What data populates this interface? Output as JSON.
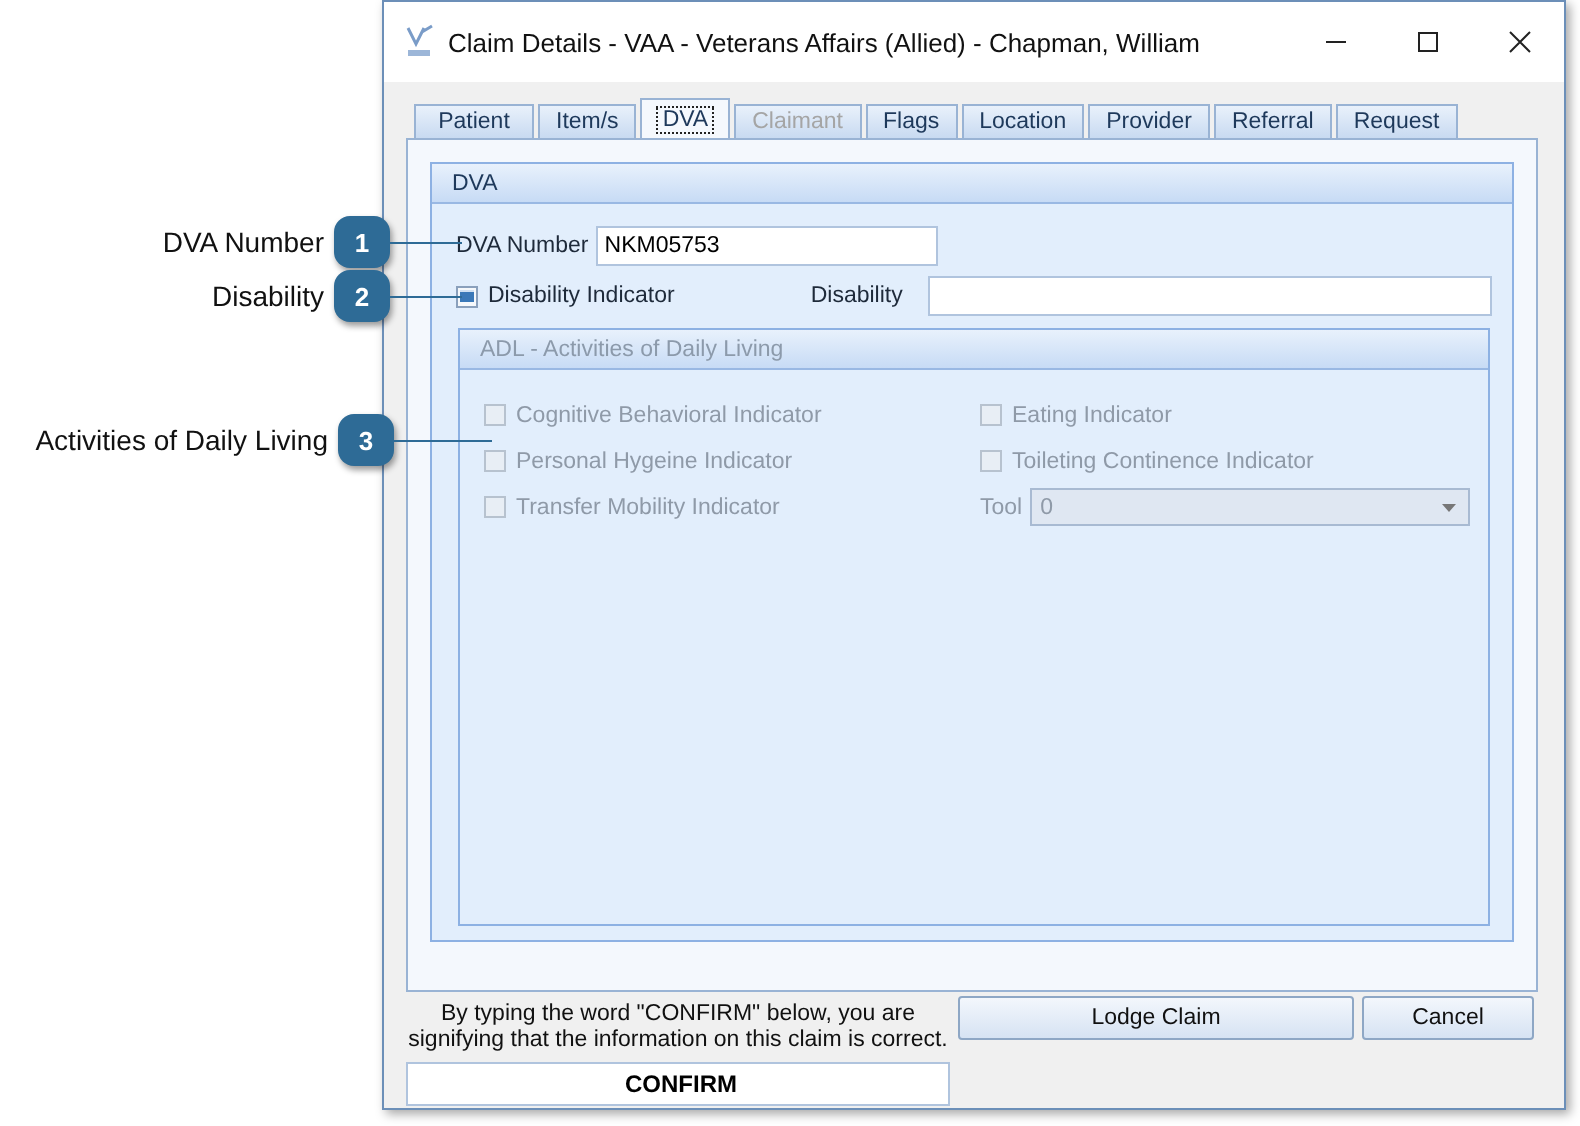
{
  "callouts": [
    {
      "label": "DVA Number",
      "number": "1"
    },
    {
      "label": "Disability",
      "number": "2"
    },
    {
      "label": "Activities of Daily Living",
      "number": "3"
    }
  ],
  "window": {
    "title": "Claim Details - VAA - Veterans Affairs (Allied) - Chapman, William"
  },
  "tabs": [
    {
      "label": "Patient",
      "selected": false,
      "disabled": false
    },
    {
      "label": "Item/s",
      "selected": false,
      "disabled": false
    },
    {
      "label": "DVA",
      "selected": true,
      "disabled": false
    },
    {
      "label": "Claimant",
      "selected": false,
      "disabled": true
    },
    {
      "label": "Flags",
      "selected": false,
      "disabled": false
    },
    {
      "label": "Location",
      "selected": false,
      "disabled": false
    },
    {
      "label": "Provider",
      "selected": false,
      "disabled": false
    },
    {
      "label": "Referral",
      "selected": false,
      "disabled": false
    },
    {
      "label": "Request",
      "selected": false,
      "disabled": false
    }
  ],
  "dva": {
    "title": "DVA",
    "number_label": "DVA Number",
    "number_value": "NKM05753",
    "indicator_label": "Disability Indicator",
    "indicator_checked": true,
    "disability_label": "Disability"
  },
  "adl": {
    "title": "ADL - Activities of Daily Living",
    "indicators": [
      {
        "label": "Cognitive Behavioral Indicator",
        "checked": false,
        "disabled": true
      },
      {
        "label": "Eating Indicator",
        "checked": false,
        "disabled": true
      },
      {
        "label": "Personal Hygeine Indicator",
        "checked": false,
        "disabled": true
      },
      {
        "label": "Toileting Continence Indicator",
        "checked": false,
        "disabled": true
      },
      {
        "label": "Transfer Mobility Indicator",
        "checked": false,
        "disabled": true
      }
    ],
    "tool_label": "Tool",
    "tool_value": "0"
  },
  "footer": {
    "notice": "By typing the word \"CONFIRM\" below, you are signifying that the information on this claim is correct.",
    "confirm_value": "CONFIRM",
    "buttons": [
      "Lodge Claim",
      "Cancel"
    ]
  }
}
